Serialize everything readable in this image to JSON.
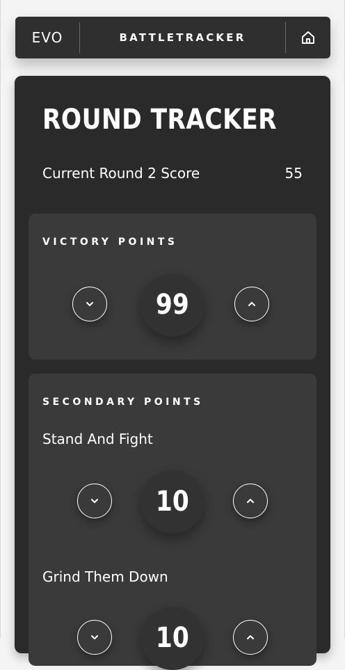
{
  "header": {
    "logo": "EVO",
    "title": "BATTLETRACKER",
    "home_icon": "home-icon"
  },
  "main": {
    "title": "ROUND TRACKER",
    "score_label": "Current Round 2 Score",
    "score_value": "55",
    "victory": {
      "heading": "VICTORY POINTS",
      "value": "99",
      "decrement_icon": "chevron-down-icon",
      "increment_icon": "chevron-up-icon"
    },
    "secondary": {
      "heading": "SECONDARY POINTS",
      "items": [
        {
          "label": "Stand And Fight",
          "value": "10"
        },
        {
          "label": "Grind Them Down",
          "value": "10"
        }
      ]
    }
  }
}
